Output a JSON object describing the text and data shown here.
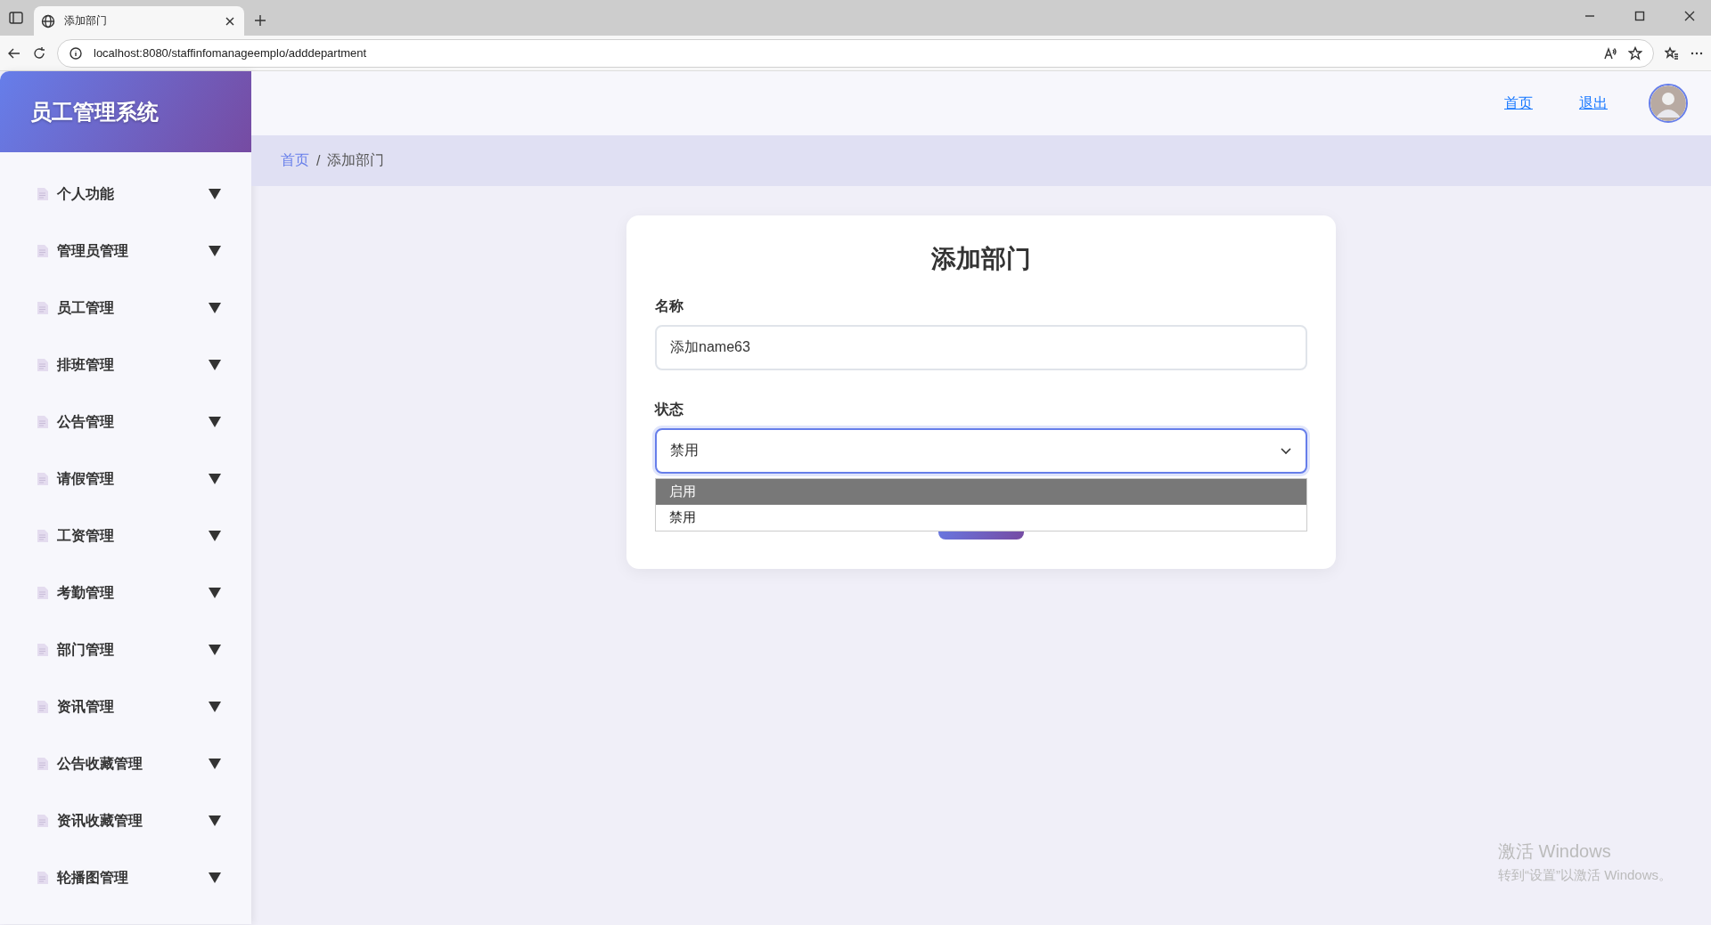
{
  "browser": {
    "tab": {
      "title": "添加部门"
    },
    "url": "localhost:8080/staffinfomanageemplo/adddepartment"
  },
  "sidebar": {
    "title": "员工管理系统",
    "items": [
      {
        "label": "个人功能",
        "expanded": false
      },
      {
        "label": "管理员管理",
        "expanded": false
      },
      {
        "label": "员工管理",
        "expanded": false
      },
      {
        "label": "排班管理",
        "expanded": false
      },
      {
        "label": "公告管理",
        "expanded": false
      },
      {
        "label": "请假管理",
        "expanded": false
      },
      {
        "label": "工资管理",
        "expanded": false
      },
      {
        "label": "考勤管理",
        "expanded": false
      },
      {
        "label": "部门管理",
        "expanded": false
      },
      {
        "label": "资讯管理",
        "expanded": false
      },
      {
        "label": "公告收藏管理",
        "expanded": false
      },
      {
        "label": "资讯收藏管理",
        "expanded": false
      },
      {
        "label": "轮播图管理",
        "expanded": false
      }
    ]
  },
  "header": {
    "links": [
      "首页",
      "退出"
    ]
  },
  "breadcrumb": {
    "items": [
      "首页",
      "添加部门"
    ],
    "separator": "/"
  },
  "form": {
    "title": "添加部门",
    "fields": [
      {
        "kind": "text",
        "label": "名称",
        "value": "添加name63"
      },
      {
        "kind": "select",
        "label": "状态",
        "value": "禁用",
        "focused": true,
        "open": true,
        "options": [
          {
            "label": "启用",
            "highlighted": true
          },
          {
            "label": "禁用",
            "highlighted": false
          }
        ]
      }
    ]
  },
  "os_notice": {
    "title": "激活 Windows",
    "text": "转到“设置”以激活 Windows。"
  }
}
